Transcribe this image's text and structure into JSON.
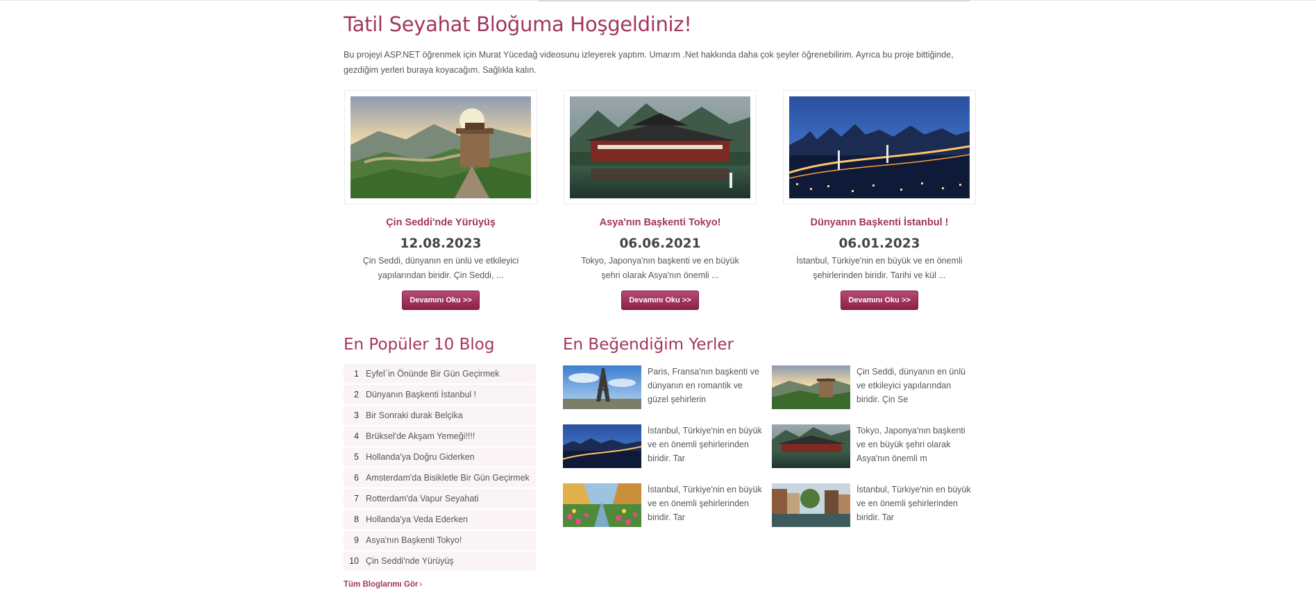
{
  "page": {
    "title": "Tatil Seyahat Bloğuma Hoşgeldiniz!",
    "intro": "Bu projeyi ASP.NET öğrenmek için Murat Yücedağ videosunu izleyerek yaptım. Umarım .Net hakkında daha çok şeyler öğrenebilirim. Ayrıca bu proje bittiğinde, gezdiğim yerleri buraya koyacağım. Sağlıkla kalın."
  },
  "featured": [
    {
      "title": "Çin Seddi'nde Yürüyüş",
      "date": "12.08.2023",
      "excerpt": "Çin Seddi, dünyanın en ünlü ve etkileyici yapılarından biridir. Çin Seddi, ...",
      "button": "Devamını Oku >>",
      "image": "great-wall-photo"
    },
    {
      "title": "Asya'nın Başkenti Tokyo!",
      "date": "06.06.2021",
      "excerpt": "Tokyo, Japonya'nın başkenti ve en büyük şehri olarak Asya'nın önemli ...",
      "button": "Devamını Oku >>",
      "image": "japanese-temple-photo"
    },
    {
      "title": "Dünyanın Başkenti İstanbul !",
      "date": "06.01.2023",
      "excerpt": "İstanbul, Türkiye'nin en büyük ve en önemli şehirlerinden biridir. Tarihi ve kül ...",
      "button": "Devamını Oku >>",
      "image": "istanbul-night-photo"
    }
  ],
  "popular": {
    "heading": "En Popüler 10 Blog",
    "items": [
      {
        "num": "1",
        "title": "Eyfel`in Önünde Bir Gün Geçirmek"
      },
      {
        "num": "2",
        "title": "Dünyanın Başkenti İstanbul !"
      },
      {
        "num": "3",
        "title": "Bir Sonraki durak Belçika"
      },
      {
        "num": "4",
        "title": "Brüksel'de Akşam Yemeği!!!!"
      },
      {
        "num": "5",
        "title": "Hollanda'ya Doğru Giderken"
      },
      {
        "num": "6",
        "title": "Amsterdam'da Bisikletle Bir Gün Geçirmek"
      },
      {
        "num": "7",
        "title": "Rotterdam'da Vapur Seyahati"
      },
      {
        "num": "8",
        "title": "Hollanda'ya Veda Ederken"
      },
      {
        "num": "9",
        "title": "Asya'nın Başkenti Tokyo!"
      },
      {
        "num": "10",
        "title": "Çin Seddi'nde Yürüyüş"
      }
    ],
    "all_link": "Tüm Bloglarımı Gör",
    "all_link_arrow": "›"
  },
  "favorites": {
    "heading": "En Beğendiğim Yerler",
    "items": [
      {
        "text": "Paris, Fransa'nın başkenti ve dünyanın en romantik ve güzel şehirlerin",
        "image": "eiffel-photo"
      },
      {
        "text": "Çin Seddi, dünyanın en ünlü ve etkileyici yapılarından biridir. Çin Se",
        "image": "great-wall-photo"
      },
      {
        "text": "İstanbul, Türkiye'nin en büyük ve en önemli şehirlerinden biridir. Tar",
        "image": "istanbul-night-photo"
      },
      {
        "text": "Tokyo, Japonya'nın başkenti ve en büyük şehri olarak Asya'nın önemli m",
        "image": "japanese-temple-photo"
      },
      {
        "text": "İstanbul, Türkiye'nin en büyük ve en önemli şehirlerinden biridir. Tar",
        "image": "amsterdam-flowers-photo"
      },
      {
        "text": "İstanbul, Türkiye'nin en büyük ve en önemli şehirlerinden biridir. Tar",
        "image": "canal-town-photo"
      }
    ]
  },
  "colors": {
    "accent": "#a23560",
    "button": "#9c2d55",
    "list_bg": "#fbf4f6"
  }
}
